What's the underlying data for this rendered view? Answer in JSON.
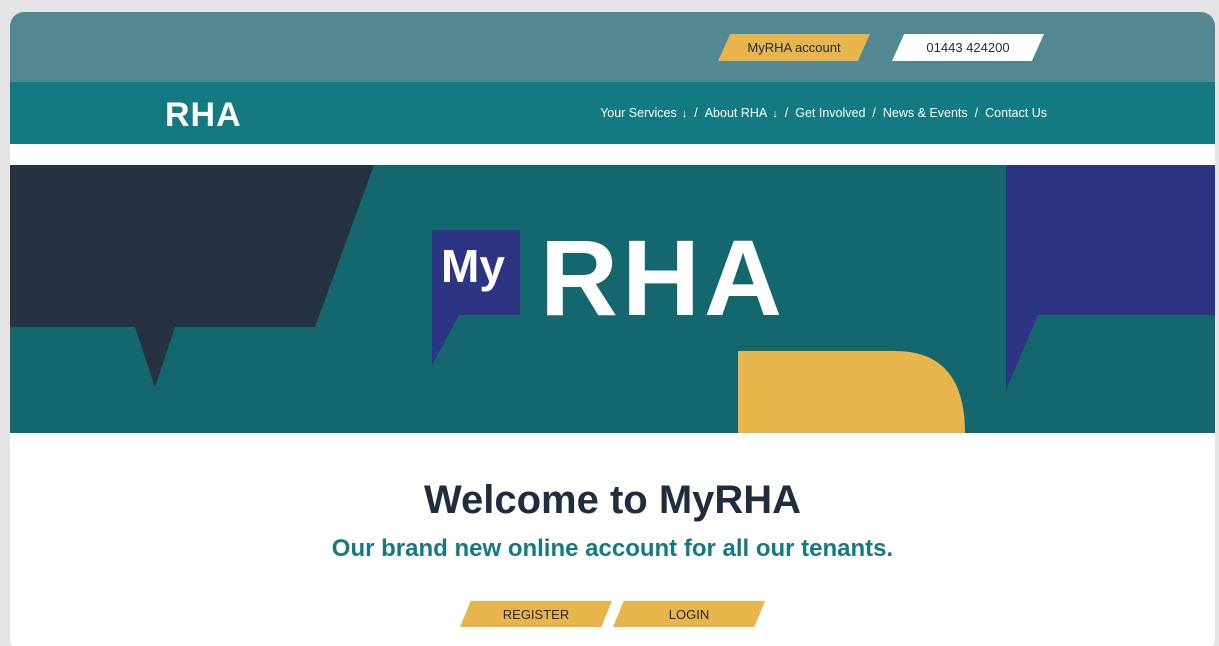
{
  "header": {
    "account_button": "MyRHA account",
    "phone_button": "01443 424200",
    "logo": "RHA"
  },
  "nav": {
    "items": [
      {
        "label": "Your Services",
        "arrow": "↓"
      },
      {
        "label": "About RHA",
        "arrow": "↓"
      },
      {
        "label": "Get Involved"
      },
      {
        "label": "News & Events"
      },
      {
        "label": "Contact Us"
      }
    ],
    "separator": "/"
  },
  "hero": {
    "logo_my": "My",
    "logo_rha": "RHA"
  },
  "main": {
    "heading": "Welcome to MyRHA",
    "tagline": "Our brand new online account for all our tenants.",
    "register_button": "REGISTER",
    "login_button": "LOGIN"
  },
  "colors": {
    "topbar": "#518891",
    "navbar": "#127a80",
    "hero_bg": "#14676d",
    "dark_navy": "#25323f",
    "purple": "#2e3484",
    "yellow": "#e8b44c",
    "heading": "#1f2d3d"
  }
}
